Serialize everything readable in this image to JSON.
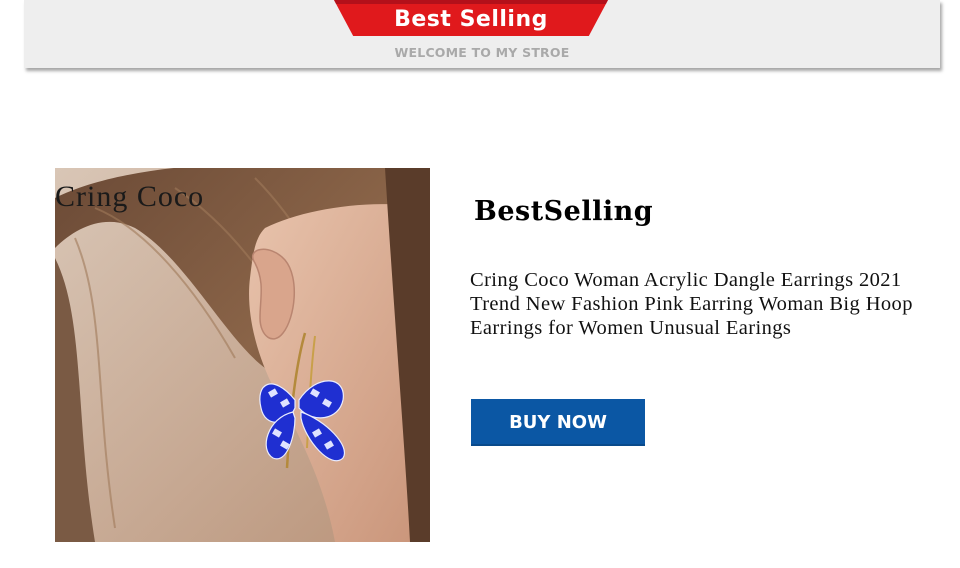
{
  "banner": {
    "ribbon_title": "Best Selling",
    "subtitle": "WELCOME TO MY STROE",
    "ribbon_color": "#e0191c"
  },
  "product": {
    "image_overlay_text": "Cring Coco",
    "section_title": "BestSelling",
    "description": "Cring Coco Woman Acrylic Dangle Earrings 2021 Trend New Fashion Pink Earring Woman Big Hoop Earrings for Women Unusual Earings",
    "earring_color": "#1f2fd1"
  },
  "actions": {
    "buy_label": "BUY NOW",
    "buy_color": "#0b57a4"
  }
}
